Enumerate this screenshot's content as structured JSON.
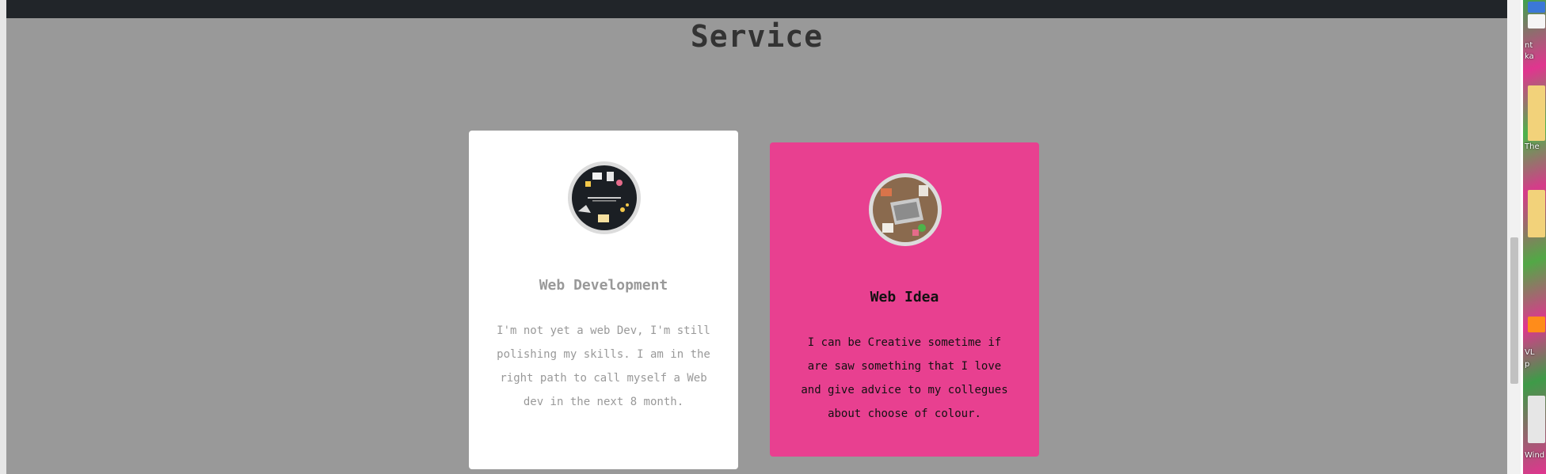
{
  "section": {
    "title": "Service"
  },
  "cards": [
    {
      "title": "Web Development",
      "text": "I'm not yet a web Dev, I'm still polishing my skills. I am in the right path to call myself a Web dev in the next 8 month.",
      "image_icon": "web-development-image-icon"
    },
    {
      "title": "Web Idea",
      "text": "I can be Creative sometime if are saw something that I love and give advice to my collegues about choose of colour.",
      "image_icon": "web-idea-image-icon"
    }
  ],
  "colors": {
    "page_background": "#999999",
    "top_bar": "#212529",
    "card_white": "#ffffff",
    "card_pink": "#e84090"
  },
  "desktop": {
    "labels": [
      "nt",
      "ka",
      "The",
      "VL",
      "p",
      "Wind"
    ]
  }
}
